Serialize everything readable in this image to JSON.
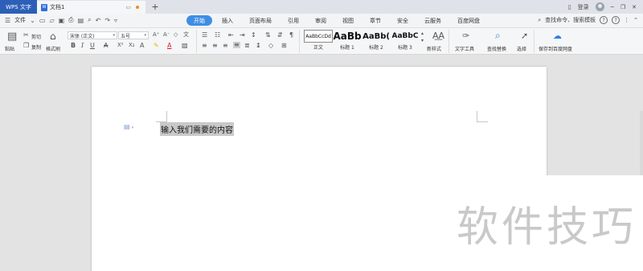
{
  "titlebar": {
    "app_tab": "WPS 文字",
    "doc_badge": "W",
    "doc_tab": "文档1",
    "new_tab": "+",
    "login": "登录"
  },
  "menubar": {
    "file": "文件",
    "tabs": [
      "开始",
      "插入",
      "页面布局",
      "引用",
      "审阅",
      "视图",
      "章节",
      "安全",
      "云服务",
      "百度网盘"
    ],
    "search": "查找命令、搜索模板"
  },
  "ribbon": {
    "paste": "粘贴",
    "cut": "剪切",
    "copy": "复制",
    "format_painter": "格式刷",
    "font_name": "宋体 (正文)",
    "font_size": "五号",
    "styles": [
      {
        "sample": "AaBbCcDd",
        "name": "正文"
      },
      {
        "sample": "AaBb",
        "name": "标题 1"
      },
      {
        "sample": "AaBb(",
        "name": "标题 2"
      },
      {
        "sample": "AaBbC",
        "name": "标题 3"
      }
    ],
    "new_style": "新样式",
    "text_tools": "文字工具",
    "find_replace": "查找替换",
    "select": "选择",
    "save_cloud": "保存到百度网盘"
  },
  "document": {
    "text": "输入我们需要的内容"
  },
  "watermark": "软件技巧",
  "colors": {
    "accent": "#3f8ee6",
    "app_tab": "#2b5fb8",
    "selection": "#c9c9c9"
  }
}
